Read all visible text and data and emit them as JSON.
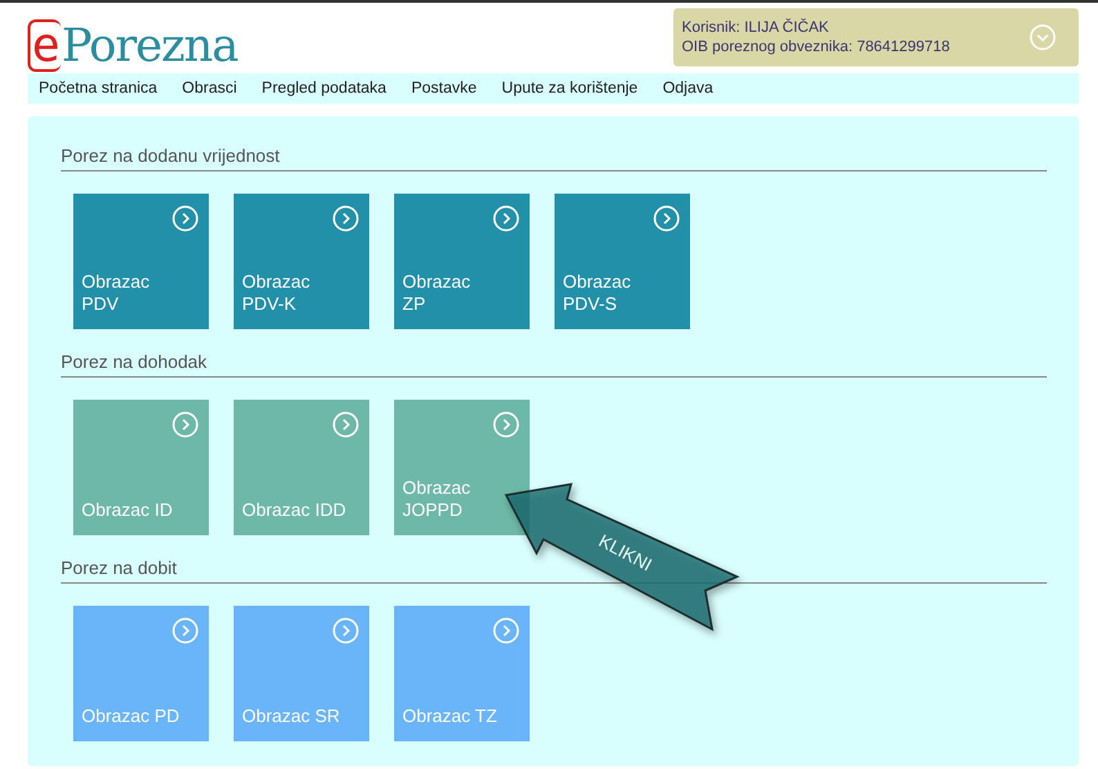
{
  "logo": {
    "prefix": "e",
    "name": "Porezna"
  },
  "user": {
    "name_line": "Korisnik: ILIJA ČIČAK",
    "oib_line": "OIB poreznog obveznika: 78641299718"
  },
  "nav": [
    "Početna stranica",
    "Obrasci",
    "Pregled podataka",
    "Postavke",
    "Upute za korištenje",
    "Odjava"
  ],
  "sections": [
    {
      "title": "Porez na dodanu vrijednost",
      "color": "#2290a8",
      "tiles": [
        {
          "label": "Obrazac\nPDV"
        },
        {
          "label": "Obrazac\nPDV-K"
        },
        {
          "label": "Obrazac\nZP"
        },
        {
          "label": "Obrazac\nPDV-S"
        }
      ]
    },
    {
      "title": "Porez na dohodak",
      "color": "#6db8a8",
      "tiles": [
        {
          "label": "Obrazac ID"
        },
        {
          "label": "Obrazac IDD"
        },
        {
          "label": "Obrazac\nJOPPD"
        }
      ]
    },
    {
      "title": "Porez na dobit",
      "color": "#6ab4fa",
      "tiles": [
        {
          "label": "Obrazac PD"
        },
        {
          "label": "Obrazac SR"
        },
        {
          "label": "Obrazac TZ"
        }
      ]
    }
  ],
  "callout": {
    "label": "KLIKNI"
  }
}
